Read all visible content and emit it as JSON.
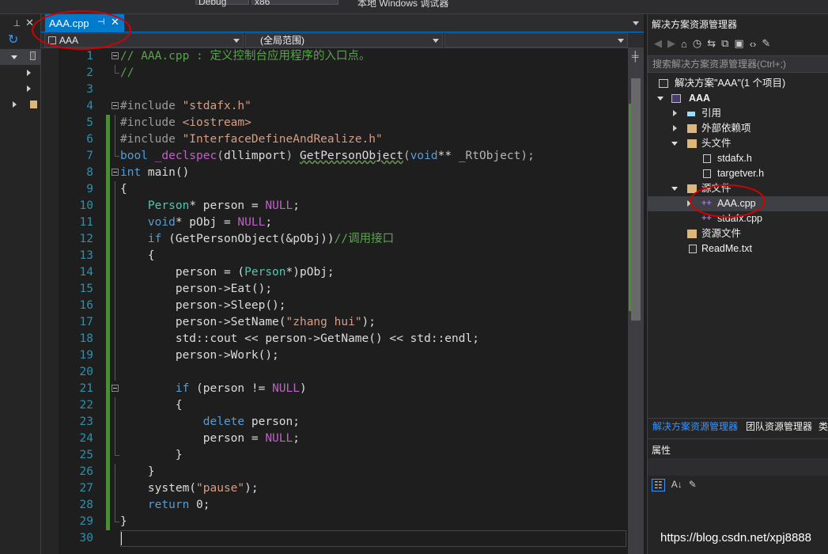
{
  "topstrip": {
    "text1": "Debug",
    "text2": "x86",
    "text3": "本地 Windows 调试器"
  },
  "left_panel": {
    "pin": "📌",
    "close": "✕"
  },
  "editor_tab": {
    "label": "AAA.cpp",
    "pin": "⊣",
    "close": "✕"
  },
  "nav_bar": {
    "project": "AAA",
    "scope": "(全局范围)",
    "member": ""
  },
  "code": {
    "lines": [
      "1",
      "2",
      "3",
      "4",
      "5",
      "6",
      "7",
      "8",
      "9",
      "10",
      "11",
      "12",
      "13",
      "14",
      "15",
      "16",
      "17",
      "18",
      "19",
      "20",
      "21",
      "22",
      "23",
      "24",
      "25",
      "26",
      "27",
      "28",
      "29",
      "30"
    ]
  },
  "solution_explorer": {
    "title": "解决方案资源管理器",
    "search_placeholder": "搜索解决方案资源管理器(Ctrl+;)",
    "solution": "解决方案\"AAA\"(1 个项目)",
    "project": "AAA",
    "references": "引用",
    "external_deps": "外部依赖项",
    "header_files": "头文件",
    "stdafx_h": "stdafx.h",
    "targetver_h": "targetver.h",
    "source_files": "源文件",
    "aaa_cpp": "AAA.cpp",
    "stdafx_cpp": "stdafx.cpp",
    "resource_files": "资源文件",
    "readme": "ReadMe.txt"
  },
  "bottom_tabs": {
    "solution_tab": "解决方案资源管理器",
    "team_tab": "团队资源管理器",
    "class_tab": "类"
  },
  "properties": {
    "title": "属性"
  },
  "watermark": "https://blog.csdn.net/xpj8888",
  "colors": {
    "accent": "#007acc",
    "annotation_red": "#d40000",
    "change_bar_green": "#4e8c3a"
  }
}
